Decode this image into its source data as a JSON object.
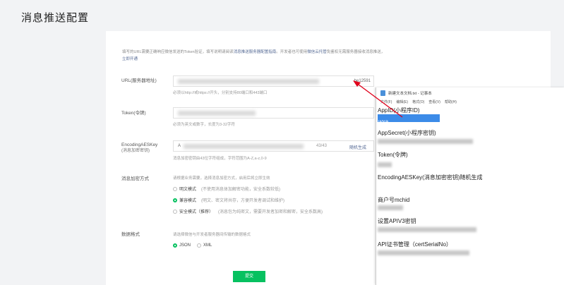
{
  "page": {
    "title": "消息推送配置"
  },
  "form": {
    "description_1": "填写的URL需要正确响应微信发送的Token验证，填写说明请阅读",
    "description_link": "消息推送服务器配置指南",
    "description_2": "。开发者也可使用",
    "description_link2": "微信云托管",
    "description_3": "免鉴权无需服务器接收消息推送，",
    "description_link3": "立即开通",
    "url": {
      "label": "URL(服务器地址)",
      "suffix": "be12591",
      "hint": "必须以http://或https://开头，分别支持80端口和443端口"
    },
    "token": {
      "label": "Token(令牌)",
      "hint": "必须为英文或数字，长度为3-32字符"
    },
    "aeskey": {
      "label": "EncodingAESKey",
      "sublabel": "(消息加密密钥)",
      "value": "A",
      "counter": "43/43",
      "generate": "随机生成",
      "hint": "消息加密密钥由43位字符组成，字符范围为A-Z,a-z,0-9"
    },
    "encrypt": {
      "label": "消息加密方式",
      "hint": "请根据业务需要，选择消息加密方式，启用后将立即生效",
      "options": [
        {
          "name": "明文模式",
          "note": "(不使用消息体加解密功能，安全系数较低)"
        },
        {
          "name": "兼容模式",
          "note": "(明文、密文将共存，方便开发者调试和维护)"
        },
        {
          "name": "安全模式（推荐）",
          "note": "(消息包为纯密文，需要开发者加密和解密，安全系数高)"
        }
      ]
    },
    "format": {
      "label": "数据格式",
      "hint": "请选择微信与开发者服务器间传输的数据格式",
      "options": [
        "JSON",
        "XML"
      ]
    },
    "submit": "提交"
  },
  "notepad": {
    "title": "新建文本文档.txt - 记事本",
    "menu": [
      "文件(F)",
      "编辑(E)",
      "格式(O)",
      "查看(V)",
      "帮助(H)"
    ],
    "lines": [
      "AppID(小程序ID)",
      "AppSecret(小程序密钥)",
      "Token(令牌)",
      "EncodingAESKey(消息加密密钥)随机生成",
      "商户号mchid",
      "设置APIV3密钥",
      "API证书管理（certSerialNo）"
    ],
    "selected_text": "wxa"
  },
  "colors": {
    "accent": "#07c160",
    "link": "#576b95",
    "arrow": "#e0001b",
    "selection": "#3c8be8"
  }
}
